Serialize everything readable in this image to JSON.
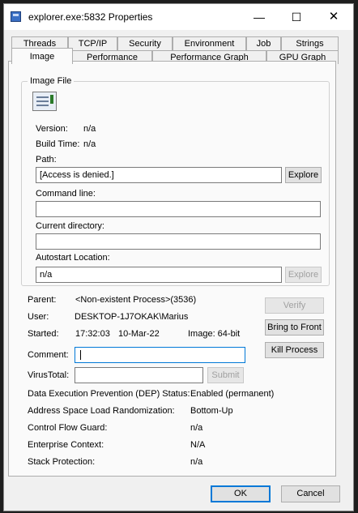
{
  "window": {
    "title": "explorer.exe:5832 Properties"
  },
  "tabs_row1": [
    "Threads",
    "TCP/IP",
    "Security",
    "Environment",
    "Job",
    "Strings"
  ],
  "tabs_row2": [
    "Image",
    "Performance",
    "Performance Graph",
    "GPU Graph"
  ],
  "image_file": {
    "group_label": "Image File",
    "version_label": "Version:",
    "version_value": "n/a",
    "build_time_label": "Build Time:",
    "build_time_value": "n/a",
    "path_label": "Path:",
    "path_value": "[Access is denied.]",
    "explore_label": "Explore",
    "command_line_label": "Command line:",
    "command_line_value": "",
    "current_directory_label": "Current directory:",
    "current_directory_value": "",
    "autostart_label": "Autostart Location:",
    "autostart_value": "n/a",
    "autostart_explore_label": "Explore"
  },
  "process": {
    "parent_label": "Parent:",
    "parent_value": "<Non-existent Process>(3536)",
    "user_label": "User:",
    "user_value": "DESKTOP-1J7OKAK\\Marius",
    "started_label": "Started:",
    "started_time": "17:32:03",
    "started_date": "10-Mar-22",
    "image_bits": "Image: 64-bit",
    "verify_label": "Verify",
    "bring_to_front_label": "Bring to Front",
    "kill_process_label": "Kill Process",
    "comment_label": "Comment:",
    "comment_value": "",
    "virustotal_label": "VirusTotal:",
    "virustotal_value": "",
    "submit_label": "Submit"
  },
  "security_info": [
    {
      "label": "Data Execution Prevention (DEP) Status:",
      "value": "Enabled (permanent)"
    },
    {
      "label": "Address Space Load Randomization:",
      "value": "Bottom-Up"
    },
    {
      "label": "Control Flow Guard:",
      "value": "n/a"
    },
    {
      "label": "Enterprise Context:",
      "value": "N/A"
    },
    {
      "label": "Stack Protection:",
      "value": "n/a"
    }
  ],
  "footer": {
    "ok_label": "OK",
    "cancel_label": "Cancel"
  }
}
